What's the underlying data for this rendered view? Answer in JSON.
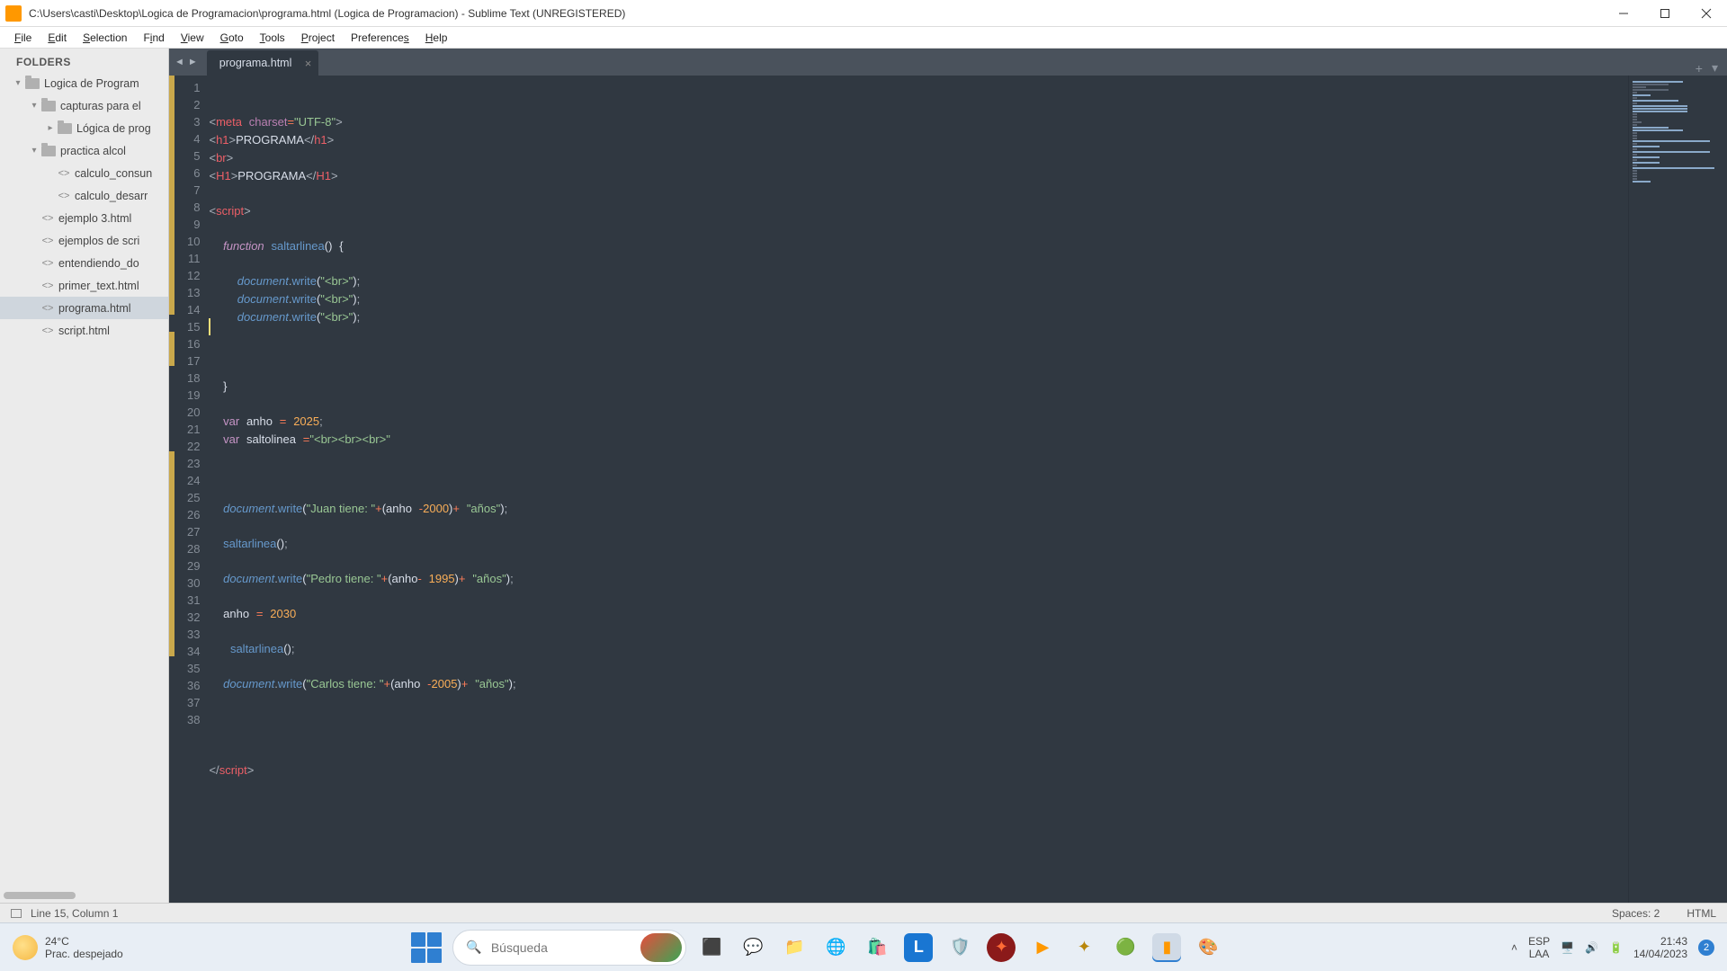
{
  "window": {
    "title": "C:\\Users\\casti\\Desktop\\Logica de Programacion\\programa.html (Logica de Programacion) - Sublime Text (UNREGISTERED)"
  },
  "menu": {
    "file": "File",
    "edit": "Edit",
    "selection": "Selection",
    "find": "Find",
    "view": "View",
    "goto": "Goto",
    "tools": "Tools",
    "project": "Project",
    "preferences": "Preferences",
    "help": "Help"
  },
  "sidebar": {
    "header": "FOLDERS",
    "items": [
      {
        "label": "Logica de Program",
        "type": "folder",
        "depth": 0,
        "arrow": "▾"
      },
      {
        "label": "capturas para el",
        "type": "folder",
        "depth": 1,
        "arrow": "▾"
      },
      {
        "label": "Lógica de prog",
        "type": "folder",
        "depth": 2,
        "arrow": "▸"
      },
      {
        "label": "practica alcol",
        "type": "folder",
        "depth": 1,
        "arrow": "▾"
      },
      {
        "label": "calculo_consun",
        "type": "file",
        "depth": 2
      },
      {
        "label": "calculo_desarr",
        "type": "file",
        "depth": 2
      },
      {
        "label": "ejemplo 3.html",
        "type": "file",
        "depth": 1
      },
      {
        "label": "ejemplos de scri",
        "type": "file",
        "depth": 1
      },
      {
        "label": "entendiendo_do",
        "type": "file",
        "depth": 1
      },
      {
        "label": "primer_text.html",
        "type": "file",
        "depth": 1
      },
      {
        "label": "programa.html",
        "type": "file",
        "depth": 1,
        "selected": true
      },
      {
        "label": "script.html",
        "type": "file",
        "depth": 1
      }
    ]
  },
  "tabs": {
    "active": "programa.html"
  },
  "editor": {
    "cursor_line": 15,
    "lines_count": 38,
    "mod_lines": [
      1,
      2,
      3,
      4,
      5,
      6,
      7,
      8,
      9,
      10,
      11,
      12,
      13,
      14,
      16,
      17,
      23,
      24,
      25,
      26,
      27,
      28,
      29,
      30,
      31,
      32,
      33,
      34
    ]
  },
  "code": {
    "l1": {
      "tag_meta": "meta",
      "attr_charset": "charset",
      "val_utf": "\"UTF-8\""
    },
    "l2": {
      "tag_h1": "h1",
      "txt": "PROGRAMA"
    },
    "l3": {
      "tag_br": "br"
    },
    "l4": {
      "tag_H1": "H1",
      "txt": "PROGRAMA"
    },
    "l6": {
      "tag_script": "script"
    },
    "l8": {
      "kw_function": "function",
      "fn": "saltarlinea"
    },
    "l10": {
      "obj": "document",
      "mth": "write",
      "str": "\"<br>\""
    },
    "l16": {
      "brace": "}"
    },
    "l18": {
      "kw_var": "var",
      "name": "anho",
      "val": "2025"
    },
    "l19": {
      "kw_var": "var",
      "name": "saltolinea",
      "val": "\"<br><br><br>\""
    },
    "l23": {
      "obj": "document",
      "mth": "write",
      "s1": "\"Juan tiene: \"",
      "v": "anho",
      "n": "2000",
      "s2": "\"años\""
    },
    "l25": {
      "fn": "saltarlinea"
    },
    "l27": {
      "obj": "document",
      "mth": "write",
      "s1": "\"Pedro tiene: \"",
      "v": "anho",
      "n": "1995",
      "s2": "\"años\""
    },
    "l29": {
      "name": "anho",
      "val": "2030"
    },
    "l31": {
      "fn": "saltarlinea"
    },
    "l33": {
      "obj": "document",
      "mth": "write",
      "s1": "\"Carlos tiene: \"",
      "v": "anho",
      "n": "2005",
      "s2": "\"años\""
    },
    "l38": {
      "tag_script": "script"
    }
  },
  "statusbar": {
    "pos": "Line 15, Column 1",
    "spaces": "Spaces: 2",
    "lang": "HTML"
  },
  "taskbar": {
    "temp": "24°C",
    "weather_desc": "Prac. despejado",
    "search_placeholder": "Búsqueda",
    "lang1": "ESP",
    "lang2": "LAA",
    "time": "21:43",
    "date": "14/04/2023",
    "notif_count": "2"
  }
}
